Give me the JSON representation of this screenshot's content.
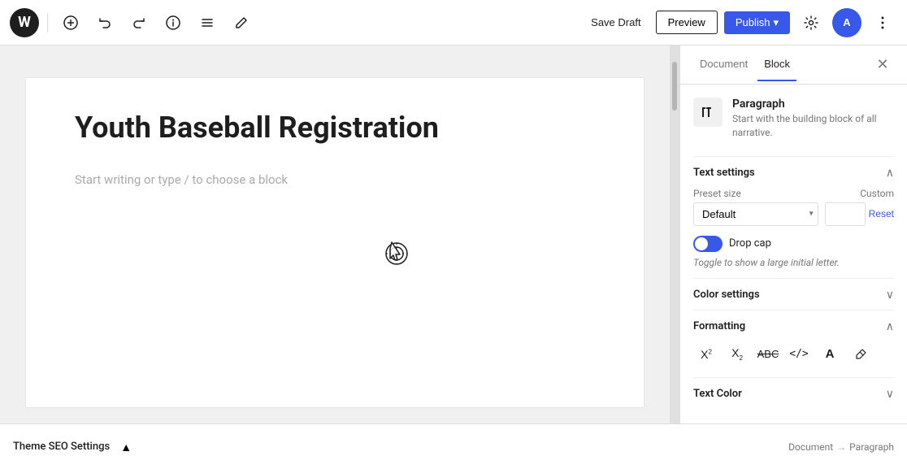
{
  "toolbar": {
    "logo": "W",
    "save_draft_label": "Save Draft",
    "preview_label": "Preview",
    "publish_label": "Publish",
    "publish_arrow": "▾",
    "user_initials": "A"
  },
  "editor": {
    "post_title": "Youth Baseball Registration",
    "body_placeholder": "Start writing or type / to choose a block"
  },
  "bottom_bar": {
    "theme_seo_label": "Theme SEO Settings",
    "breadcrumb_document": "Document",
    "breadcrumb_sep": "→",
    "breadcrumb_block": "Paragraph"
  },
  "panel": {
    "tab_document": "Document",
    "tab_block": "Block",
    "block_name": "Paragraph",
    "block_description": "Start with the building block of all narrative.",
    "text_settings_label": "Text settings",
    "preset_size_label": "Preset size",
    "custom_label": "Custom",
    "preset_default": "Default",
    "reset_label": "Reset",
    "drop_cap_label": "Drop cap",
    "drop_cap_hint": "Toggle to show a large initial letter.",
    "color_settings_label": "Color settings",
    "formatting_label": "Formatting",
    "text_color_label": "Text Color"
  }
}
